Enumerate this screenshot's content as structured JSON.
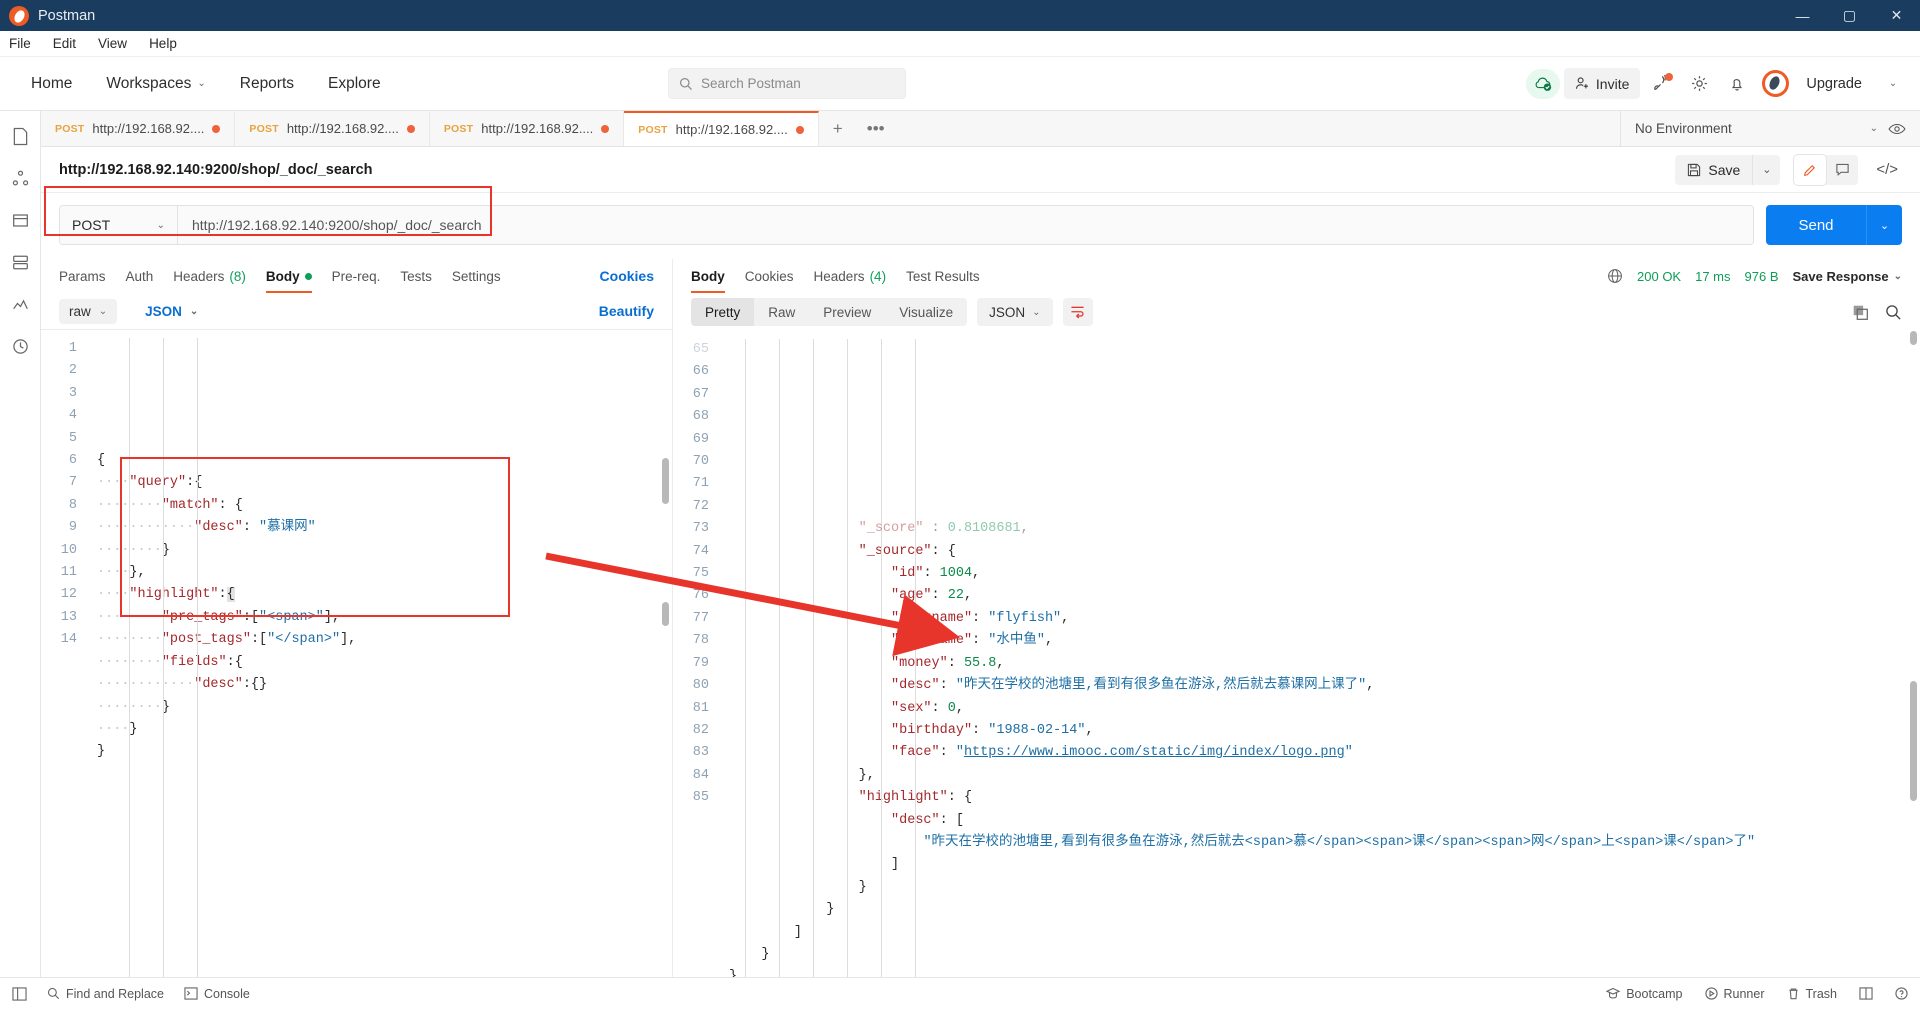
{
  "titlebar": {
    "app_name": "Postman",
    "minimize": "—",
    "maximize": "▢",
    "close": "✕"
  },
  "menubar": {
    "items": [
      "File",
      "Edit",
      "View",
      "Help"
    ]
  },
  "header": {
    "nav": [
      "Home",
      "Workspaces",
      "Reports",
      "Explore"
    ],
    "search_placeholder": "Search Postman",
    "invite_label": "Invite",
    "upgrade_label": "Upgrade"
  },
  "tabstrip": {
    "tabs": [
      {
        "method": "POST",
        "title": "http://192.168.92....",
        "dirty": true,
        "active": false
      },
      {
        "method": "POST",
        "title": "http://192.168.92....",
        "dirty": true,
        "active": false
      },
      {
        "method": "POST",
        "title": "http://192.168.92....",
        "dirty": true,
        "active": false
      },
      {
        "method": "POST",
        "title": "http://192.168.92....",
        "dirty": true,
        "active": true
      }
    ],
    "add_label": "+",
    "more_label": "•••",
    "environment": "No Environment"
  },
  "request": {
    "name": "http://192.168.92.140:9200/shop/_doc/_search",
    "save_label": "Save",
    "method": "POST",
    "url": "http://192.168.92.140:9200/shop/_doc/_search",
    "send_label": "Send",
    "tabs": [
      {
        "label": "Params",
        "active": false
      },
      {
        "label": "Auth",
        "active": false
      },
      {
        "label": "Headers",
        "count": "(8)",
        "active": false
      },
      {
        "label": "Body",
        "dot": true,
        "active": true
      },
      {
        "label": "Pre-req.",
        "active": false
      },
      {
        "label": "Tests",
        "active": false
      },
      {
        "label": "Settings",
        "active": false
      }
    ],
    "cookies_link": "Cookies",
    "body_mode": "raw",
    "body_lang": "JSON",
    "beautify_label": "Beautify",
    "body_lines": [
      {
        "n": 1,
        "indent": 0,
        "tokens": [
          {
            "t": "{",
            "c": "p"
          }
        ]
      },
      {
        "n": 2,
        "indent": 1,
        "tokens": [
          {
            "t": "\"query\"",
            "c": "k"
          },
          {
            "t": ":{",
            "c": "p"
          }
        ]
      },
      {
        "n": 3,
        "indent": 2,
        "tokens": [
          {
            "t": "\"match\"",
            "c": "k"
          },
          {
            "t": ": {",
            "c": "p"
          }
        ]
      },
      {
        "n": 4,
        "indent": 3,
        "tokens": [
          {
            "t": "\"desc\"",
            "c": "k"
          },
          {
            "t": ": ",
            "c": "p"
          },
          {
            "t": "\"慕课网\"",
            "c": "s"
          }
        ]
      },
      {
        "n": 5,
        "indent": 2,
        "tokens": [
          {
            "t": "}",
            "c": "p"
          }
        ]
      },
      {
        "n": 6,
        "indent": 1,
        "tokens": [
          {
            "t": "},",
            "c": "p"
          }
        ]
      },
      {
        "n": 7,
        "indent": 1,
        "tokens": [
          {
            "t": "\"highlight\"",
            "c": "k"
          },
          {
            "t": ":",
            "c": "p"
          },
          {
            "t": "{",
            "c": "curbrace"
          }
        ]
      },
      {
        "n": 8,
        "indent": 2,
        "tokens": [
          {
            "t": "\"pre_tags\"",
            "c": "k"
          },
          {
            "t": ":[",
            "c": "p"
          },
          {
            "t": "\"<span>\"",
            "c": "s"
          },
          {
            "t": "],",
            "c": "p"
          }
        ]
      },
      {
        "n": 9,
        "indent": 2,
        "tokens": [
          {
            "t": "\"post_tags\"",
            "c": "k"
          },
          {
            "t": ":[",
            "c": "p"
          },
          {
            "t": "\"</span>\"",
            "c": "s"
          },
          {
            "t": "],",
            "c": "p"
          }
        ]
      },
      {
        "n": 10,
        "indent": 2,
        "tokens": [
          {
            "t": "\"fields\"",
            "c": "k"
          },
          {
            "t": ":{",
            "c": "p"
          }
        ]
      },
      {
        "n": 11,
        "indent": 3,
        "tokens": [
          {
            "t": "\"desc\"",
            "c": "k"
          },
          {
            "t": ":{}",
            "c": "p"
          }
        ]
      },
      {
        "n": 12,
        "indent": 2,
        "tokens": [
          {
            "t": "}",
            "c": "p"
          }
        ]
      },
      {
        "n": 13,
        "indent": 1,
        "tokens": [
          {
            "t": "}",
            "c": "p"
          }
        ]
      },
      {
        "n": 14,
        "indent": 0,
        "tokens": [
          {
            "t": "}",
            "c": "p"
          }
        ]
      }
    ]
  },
  "response": {
    "tabs": [
      {
        "label": "Body",
        "active": true
      },
      {
        "label": "Cookies",
        "active": false
      },
      {
        "label": "Headers",
        "count": "(4)",
        "active": false
      },
      {
        "label": "Test Results",
        "active": false
      }
    ],
    "status_code": "200 OK",
    "time": "17 ms",
    "size": "976 B",
    "save_response_label": "Save Response",
    "view_modes": [
      "Pretty",
      "Raw",
      "Preview",
      "Visualize"
    ],
    "active_view": "Pretty",
    "format": "JSON",
    "lines": [
      {
        "n": 65,
        "indent": 4,
        "clipped": true,
        "tokens": [
          {
            "t": "\"_score\"",
            "c": "k"
          },
          {
            "t": " : ",
            "c": "p"
          },
          {
            "t": "0.8108681",
            "c": "n"
          },
          {
            "t": ",",
            "c": "p"
          }
        ]
      },
      {
        "n": 66,
        "indent": 4,
        "tokens": [
          {
            "t": "\"_source\"",
            "c": "k"
          },
          {
            "t": ": {",
            "c": "p"
          }
        ]
      },
      {
        "n": 67,
        "indent": 5,
        "tokens": [
          {
            "t": "\"id\"",
            "c": "k"
          },
          {
            "t": ": ",
            "c": "p"
          },
          {
            "t": "1004",
            "c": "n"
          },
          {
            "t": ",",
            "c": "p"
          }
        ]
      },
      {
        "n": 68,
        "indent": 5,
        "tokens": [
          {
            "t": "\"age\"",
            "c": "k"
          },
          {
            "t": ": ",
            "c": "p"
          },
          {
            "t": "22",
            "c": "n"
          },
          {
            "t": ",",
            "c": "p"
          }
        ]
      },
      {
        "n": 69,
        "indent": 5,
        "tokens": [
          {
            "t": "\"username\"",
            "c": "k"
          },
          {
            "t": ": ",
            "c": "p"
          },
          {
            "t": "\"flyfish\"",
            "c": "s"
          },
          {
            "t": ",",
            "c": "p"
          }
        ]
      },
      {
        "n": 70,
        "indent": 5,
        "tokens": [
          {
            "t": "\"nickname\"",
            "c": "k"
          },
          {
            "t": ": ",
            "c": "p"
          },
          {
            "t": "\"水中鱼\"",
            "c": "s"
          },
          {
            "t": ",",
            "c": "p"
          }
        ]
      },
      {
        "n": 71,
        "indent": 5,
        "tokens": [
          {
            "t": "\"money\"",
            "c": "k"
          },
          {
            "t": ": ",
            "c": "p"
          },
          {
            "t": "55.8",
            "c": "n"
          },
          {
            "t": ",",
            "c": "p"
          }
        ]
      },
      {
        "n": 72,
        "indent": 5,
        "tokens": [
          {
            "t": "\"desc\"",
            "c": "k"
          },
          {
            "t": ": ",
            "c": "p"
          },
          {
            "t": "\"昨天在学校的池塘里,看到有很多鱼在游泳,然后就去慕课网上课了\"",
            "c": "s"
          },
          {
            "t": ",",
            "c": "p"
          }
        ]
      },
      {
        "n": 73,
        "indent": 5,
        "tokens": [
          {
            "t": "\"sex\"",
            "c": "k"
          },
          {
            "t": ": ",
            "c": "p"
          },
          {
            "t": "0",
            "c": "n"
          },
          {
            "t": ",",
            "c": "p"
          }
        ]
      },
      {
        "n": 74,
        "indent": 5,
        "tokens": [
          {
            "t": "\"birthday\"",
            "c": "k"
          },
          {
            "t": ": ",
            "c": "p"
          },
          {
            "t": "\"1988-02-14\"",
            "c": "s"
          },
          {
            "t": ",",
            "c": "p"
          }
        ]
      },
      {
        "n": 75,
        "indent": 5,
        "tokens": [
          {
            "t": "\"face\"",
            "c": "k"
          },
          {
            "t": ": ",
            "c": "p"
          },
          {
            "t": "\"",
            "c": "s"
          },
          {
            "t": "https://www.imooc.com/static/img/index/logo.png",
            "c": "lnk"
          },
          {
            "t": "\"",
            "c": "s"
          }
        ]
      },
      {
        "n": 76,
        "indent": 4,
        "tokens": [
          {
            "t": "},",
            "c": "p"
          }
        ]
      },
      {
        "n": 77,
        "indent": 4,
        "tokens": [
          {
            "t": "\"highlight\"",
            "c": "k"
          },
          {
            "t": ": {",
            "c": "p"
          }
        ]
      },
      {
        "n": 78,
        "indent": 5,
        "tokens": [
          {
            "t": "\"desc\"",
            "c": "k"
          },
          {
            "t": ": [",
            "c": "p"
          }
        ]
      },
      {
        "n": 79,
        "indent": 6,
        "wrap": true,
        "tokens": [
          {
            "t": "\"昨天在学校的池塘里,看到有很多鱼在游泳,然后就去<span>慕</span><span>课</span><span>网</span>上<span>课</span>了\"",
            "c": "s"
          }
        ]
      },
      {
        "n": 80,
        "indent": 5,
        "tokens": [
          {
            "t": "]",
            "c": "p"
          }
        ]
      },
      {
        "n": 81,
        "indent": 4,
        "tokens": [
          {
            "t": "}",
            "c": "p"
          }
        ]
      },
      {
        "n": 82,
        "indent": 3,
        "tokens": [
          {
            "t": "}",
            "c": "p"
          }
        ]
      },
      {
        "n": 83,
        "indent": 2,
        "tokens": [
          {
            "t": "]",
            "c": "p"
          }
        ]
      },
      {
        "n": 84,
        "indent": 1,
        "tokens": [
          {
            "t": "}",
            "c": "p"
          }
        ]
      },
      {
        "n": 85,
        "indent": 0,
        "tokens": [
          {
            "t": "}",
            "c": "p"
          }
        ]
      }
    ]
  },
  "statusbar": {
    "left": [
      "Find and Replace",
      "Console"
    ],
    "right": [
      "Bootcamp",
      "Runner",
      "Trash"
    ]
  },
  "colors": {
    "accent": "#ef5b25",
    "send": "#0a7ef0",
    "annotation": "#e8352b",
    "status_ok": "#0f9d58",
    "titlebar": "#1a3c5e"
  }
}
